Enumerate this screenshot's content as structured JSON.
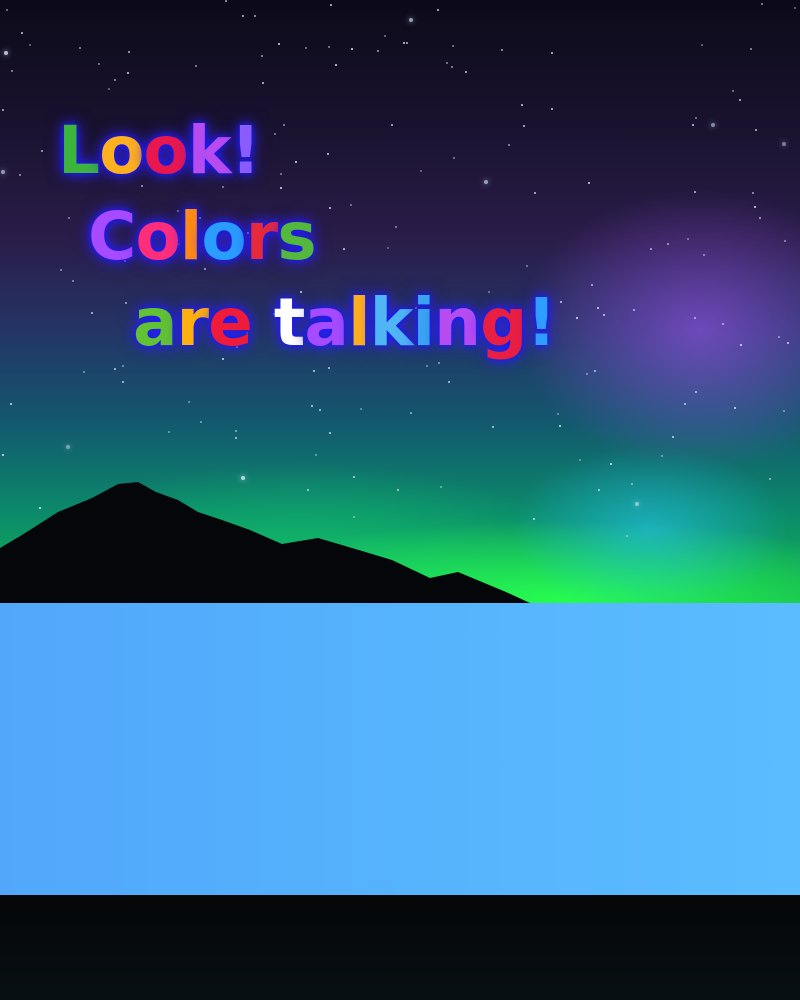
{
  "headline": {
    "lines": [
      "Look!",
      "Colors",
      "are talking!"
    ],
    "letter_colors": [
      [
        "#3db53d",
        "#ffb01e",
        "#e8184e",
        "#b64cf0",
        "#8a5cff"
      ],
      [
        "#a64bff",
        "#ff2e7a",
        "#ff8a16",
        "#2a9dff",
        "#e62a3a",
        "#54b83c"
      ],
      [
        "#62c233",
        "#ffb00f",
        "#ee1b3a",
        "#ffffff",
        "#a64bff",
        "#ffb01e",
        "#4fb5f4",
        "#3aa4f2",
        "#b64cf0",
        "#e81e42",
        "#2f9cff",
        "#4fb5f4"
      ]
    ]
  },
  "colors": {
    "panel": "#56b4fd",
    "aurora_green": "#3cf55a",
    "sky_purple": "#2a1d4a"
  }
}
